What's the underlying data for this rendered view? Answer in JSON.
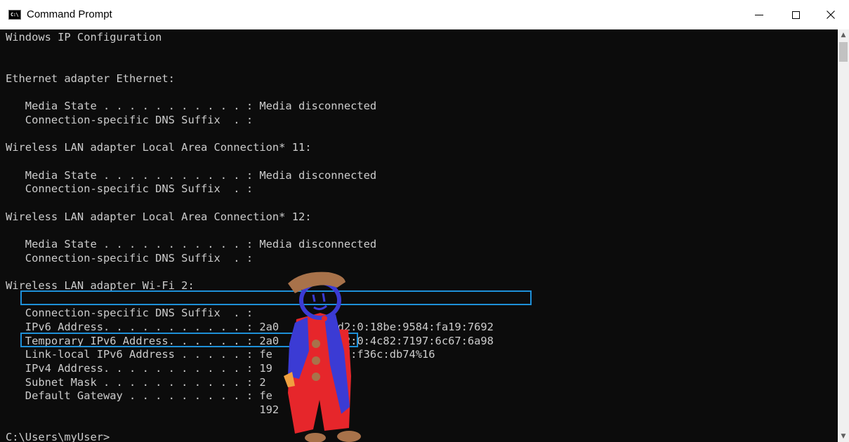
{
  "window": {
    "title": "Command Prompt",
    "icon": "cmd-icon",
    "icon_glyph": "C:\\",
    "controls": {
      "minimize": "minimize-icon",
      "maximize": "maximize-icon",
      "close": "close-icon",
      "close_glyph": "✕"
    }
  },
  "console": {
    "background": "#0c0c0c",
    "foreground": "#cccccc",
    "highlight_color": "#1e90d8",
    "lines": [
      "Windows IP Configuration",
      "",
      "",
      "Ethernet adapter Ethernet:",
      "",
      "   Media State . . . . . . . . . . . : Media disconnected",
      "   Connection-specific DNS Suffix  . :",
      "",
      "Wireless LAN adapter Local Area Connection* 11:",
      "",
      "   Media State . . . . . . . . . . . : Media disconnected",
      "   Connection-specific DNS Suffix  . :",
      "",
      "Wireless LAN adapter Local Area Connection* 12:",
      "",
      "   Media State . . . . . . . . . . . : Media disconnected",
      "   Connection-specific DNS Suffix  . :",
      "",
      "Wireless LAN adapter Wi-Fi 2:",
      "",
      "   Connection-specific DNS Suffix  . :",
      "   IPv6 Address. . . . . . . . . . . : 2a0     7:dcd2:0:18be:9584:fa19:7692",
      "   Temporary IPv6 Address. . . . . . : 2a0     7:dcd2:0:4c82:7197:6c67:6a98",
      "   Link-local IPv6 Address . . . . . : fe     94:effd:f36c:db74%16",
      "   IPv4 Address. . . . . . . . . . . : 19       1.7",
      "   Subnet Mask . . . . . . . . . . . : 2       255.0",
      "   Default Gateway . . . . . . . . . : fe       %16",
      "                                       192",
      "",
      "C:\\Users\\myUser>"
    ]
  },
  "scrollbar": {
    "up_icon": "scroll-up-arrow-icon",
    "down_icon": "scroll-down-arrow-icon",
    "up_glyph": "▲",
    "down_glyph": "▼"
  }
}
